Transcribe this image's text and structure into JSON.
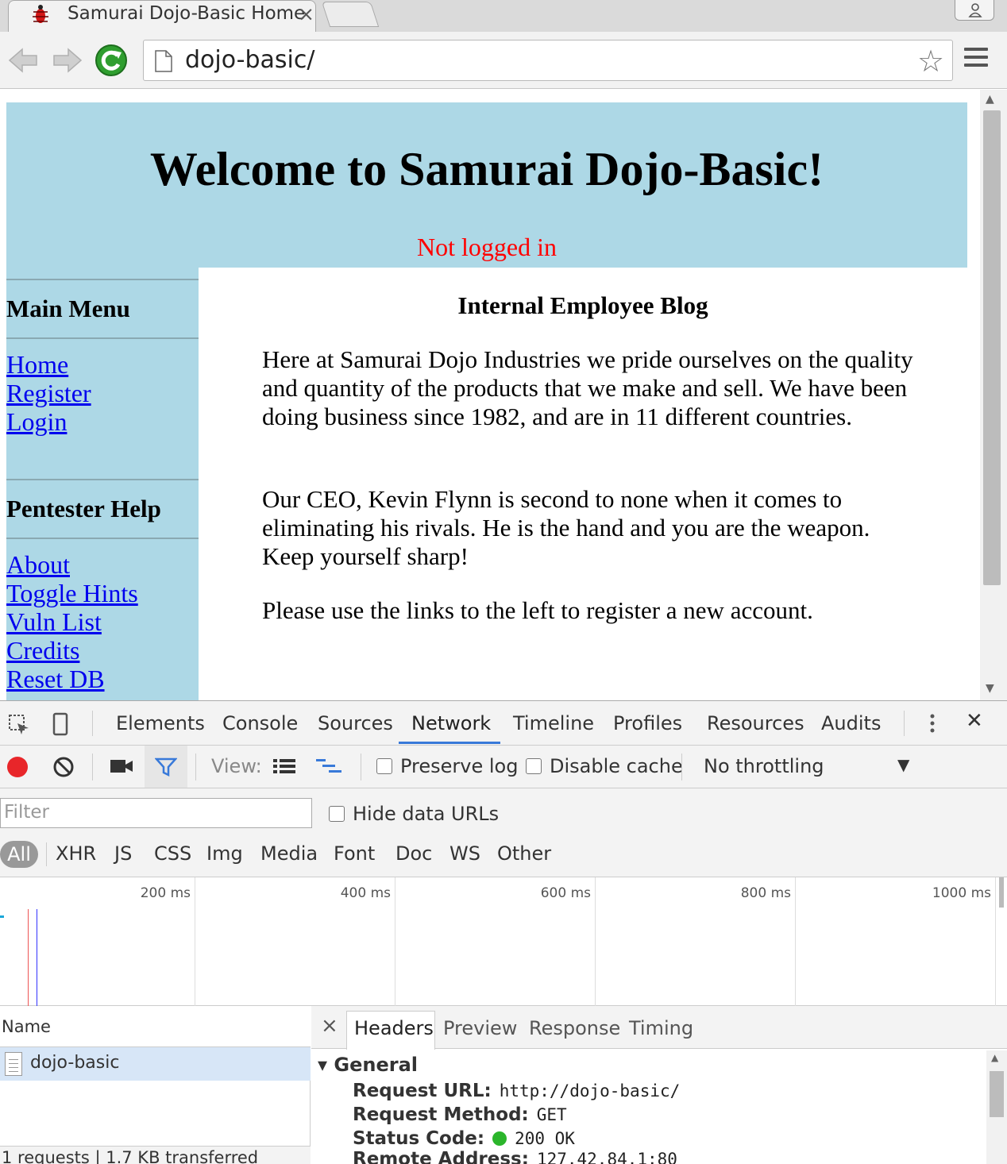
{
  "browser": {
    "tab_title": "Samurai Dojo-Basic Home",
    "tab_close": "×",
    "url": "dojo-basic/",
    "star": "☆"
  },
  "page": {
    "heading": "Welcome to Samurai Dojo-Basic!",
    "login_status": "Not logged in",
    "sidebar": {
      "main_menu_title": "Main Menu",
      "main_menu_links": [
        "Home",
        "Register",
        "Login"
      ],
      "pentester_title": "Pentester Help",
      "pentester_links": [
        "About",
        "Toggle Hints",
        "Vuln List",
        "Credits",
        "Reset DB"
      ]
    },
    "content": {
      "title": "Internal Employee Blog",
      "paragraphs": [
        "Here at Samurai Dojo Industries we pride ourselves on the quality and quantity of the products that we make and sell. We have been doing business since 1982, and are in 11 different countries.",
        "Our CEO, Kevin Flynn is second to none when it comes to eliminating his rivals. He is the hand and you are the weapon. Keep yourself sharp!",
        "Please use the links to the left to register a new account."
      ]
    }
  },
  "devtools": {
    "tabs": [
      "Elements",
      "Console",
      "Sources",
      "Network",
      "Timeline",
      "Profiles",
      "Resources",
      "Audits"
    ],
    "active_tab": "Network",
    "close": "✕",
    "toolbar": {
      "view_label": "View:",
      "preserve_log": "Preserve log",
      "disable_cache": "Disable cache",
      "throttling": "No throttling",
      "throttling_arrow": "▼"
    },
    "filter_placeholder": "Filter",
    "hide_data_urls": "Hide data URLs",
    "type_filters": [
      "All",
      "XHR",
      "JS",
      "CSS",
      "Img",
      "Media",
      "Font",
      "Doc",
      "WS",
      "Other"
    ],
    "timeline_ticks": [
      "200 ms",
      "400 ms",
      "600 ms",
      "800 ms",
      "1000 ms"
    ],
    "name_header": "Name",
    "requests": [
      "dojo-basic"
    ],
    "footer": "1 requests  |  1.7 KB transferred",
    "details": {
      "close": "×",
      "tabs": [
        "Headers",
        "Preview",
        "Response",
        "Timing"
      ],
      "active_tab": "Headers",
      "section": "▾ General",
      "request_url_label": "Request URL:",
      "request_url": "http://dojo-basic/",
      "request_method_label": "Request Method:",
      "request_method": "GET",
      "status_code_label": "Status Code:",
      "status_code": "200 OK",
      "remote_address_label": "Remote Address:",
      "remote_address": "127.42.84.1:80"
    }
  },
  "colors": {
    "header_bg": "#add8e6",
    "not_logged_in": "#ff0000",
    "link": "#0000ee",
    "devtools_accent": "#3879d9",
    "record_red": "#e8262a",
    "status_ok": "#2bb52b"
  },
  "icons": [
    "bug-favicon",
    "back-arrow-icon",
    "forward-arrow-icon",
    "reload-icon",
    "page-icon",
    "star-icon",
    "hamburger-menu-icon",
    "inspect-icon",
    "device-icon",
    "record-icon",
    "clear-icon",
    "camera-icon",
    "filter-icon",
    "list-view-icon",
    "waterfall-icon",
    "kebab-menu-icon"
  ]
}
